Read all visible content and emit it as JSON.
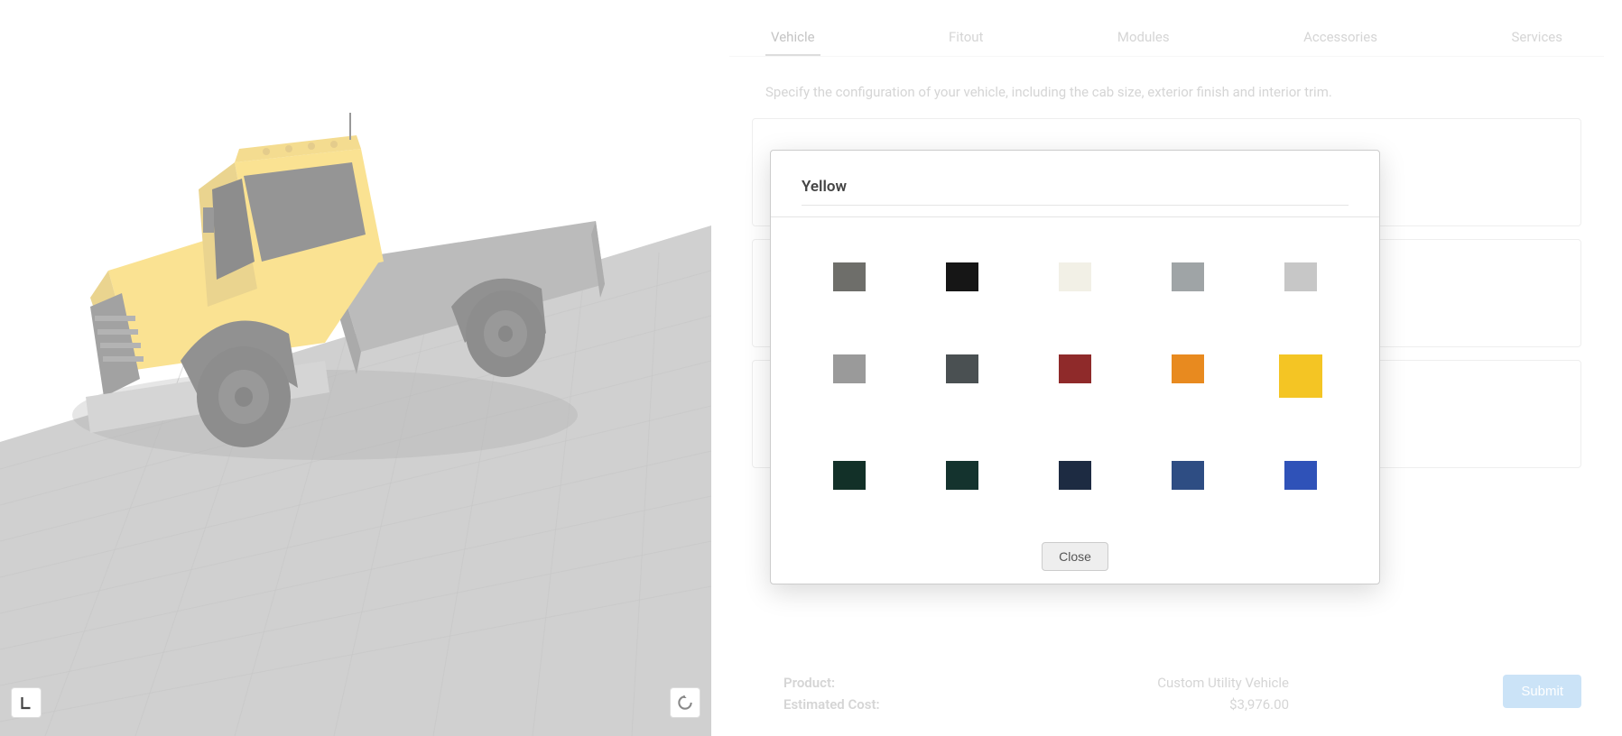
{
  "tabs": [
    "Vehicle",
    "Fitout",
    "Modules",
    "Accessories",
    "Services"
  ],
  "active_tab": 0,
  "instruction": "Specify the configuration of your vehicle, including the cab size, exterior finish and interior trim.",
  "color_modal": {
    "title": "Yellow",
    "close_label": "Close",
    "selected_index": 9,
    "swatches": [
      "#6e6e6a",
      "#161616",
      "#f2f0e6",
      "#9fa4a6",
      "#c7c7c7",
      "#9a9a9a",
      "#4a5052",
      "#8f2a2a",
      "#e88a1f",
      "#f4c524",
      "#123028",
      "#14332e",
      "#1d2b42",
      "#2e4d83",
      "#2f52b8"
    ]
  },
  "footer": {
    "product_label": "Product:",
    "product_value": "Custom Utility Vehicle",
    "cost_label": "Estimated Cost:",
    "cost_value": "$3,976.00",
    "submit_label": "Submit"
  },
  "vehicle_color": "#f4c524"
}
